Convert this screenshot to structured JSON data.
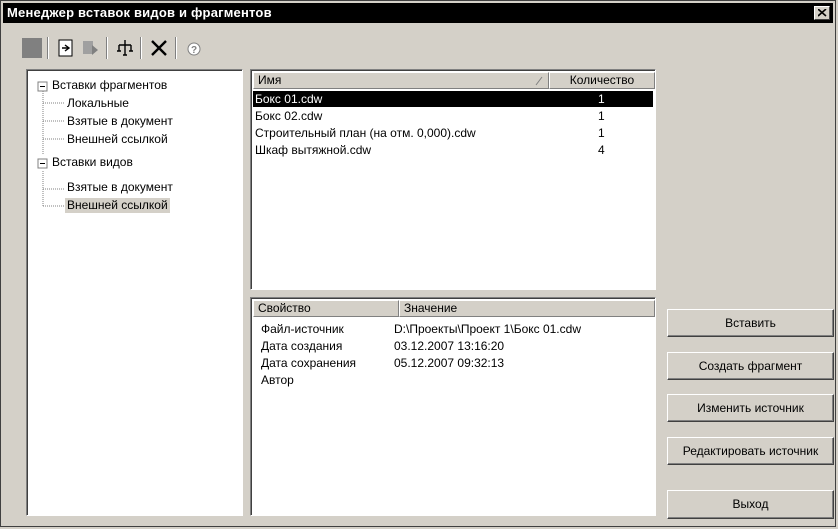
{
  "window": {
    "title": "Менеджер вставок видов и фрагментов"
  },
  "tree": {
    "items": [
      {
        "label": "Вставки фрагментов"
      },
      {
        "label": "Локальные"
      },
      {
        "label": "Взятые в документ"
      },
      {
        "label": "Внешней ссылкой"
      },
      {
        "label": "Вставки видов"
      },
      {
        "label": "Взятые в документ"
      },
      {
        "label": "Внешней ссылкой"
      }
    ]
  },
  "files": {
    "headers": {
      "name": "Имя",
      "count": "Количество"
    },
    "rows": [
      {
        "name": "Бокс 01.cdw",
        "count": "1"
      },
      {
        "name": "Бокс 02.cdw",
        "count": "1"
      },
      {
        "name": "Строительный план (на отм. 0,000).cdw",
        "count": "1"
      },
      {
        "name": "Шкаф вытяжной.cdw",
        "count": "4"
      }
    ]
  },
  "properties": {
    "headers": {
      "name": "Свойство",
      "value": "Значение"
    },
    "rows": [
      {
        "name": "Файл-источник",
        "value": "D:\\Проекты\\Проект 1\\Бокс 01.cdw"
      },
      {
        "name": "Дата создания",
        "value": "03.12.2007  13:16:20"
      },
      {
        "name": "Дата сохранения",
        "value": "05.12.2007  09:32:13"
      },
      {
        "name": "Автор",
        "value": ""
      }
    ]
  },
  "buttons": {
    "insert": "Вставить",
    "create_fragment": "Создать фрагмент",
    "change_source": "Изменить источник",
    "edit_source": "Редактировать источник",
    "exit": "Выход"
  },
  "colors": {
    "selection": "#000000",
    "face": "#d4d0c8",
    "title_bar": "#000000"
  }
}
